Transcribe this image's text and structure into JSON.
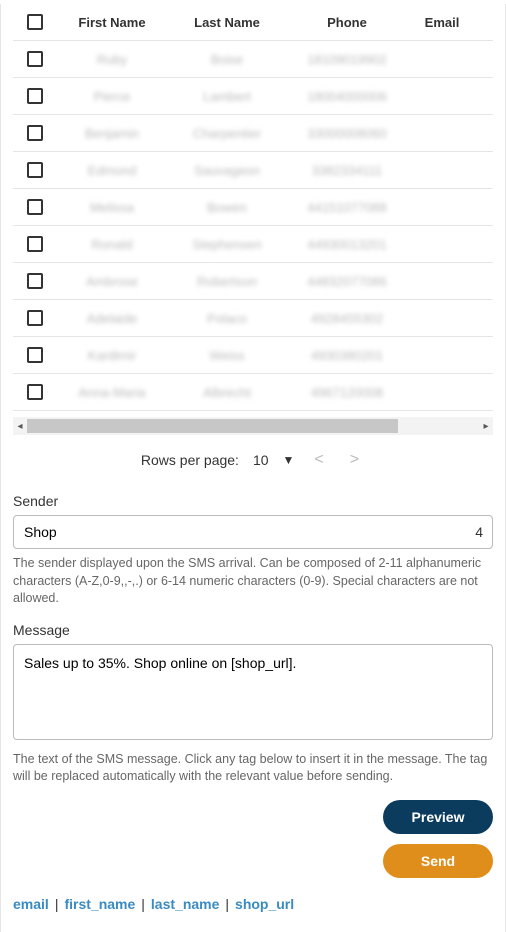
{
  "table": {
    "headers": {
      "first": "First Name",
      "last": "Last Name",
      "phone": "Phone",
      "email": "Email"
    },
    "rows": [
      {
        "first": "Ruby",
        "last": "Boise",
        "phone": "18109019902"
      },
      {
        "first": "Pierce",
        "last": "Lambert",
        "phone": "18004000006"
      },
      {
        "first": "Benjamin",
        "last": "Charpentier",
        "phone": "33000008060"
      },
      {
        "first": "Edmond",
        "last": "Sauvageon",
        "phone": "3382334111"
      },
      {
        "first": "Melissa",
        "last": "Bowen",
        "phone": "44151077088"
      },
      {
        "first": "Ronald",
        "last": "Stephensen",
        "phone": "44930013201"
      },
      {
        "first": "Ambrose",
        "last": "Robertson",
        "phone": "44832077086"
      },
      {
        "first": "Adelaide",
        "last": "Polaco",
        "phone": "4928455302"
      },
      {
        "first": "Kardimir",
        "last": "Weiss",
        "phone": "4930380201"
      },
      {
        "first": "Anna-Maria",
        "last": "Albrecht",
        "phone": "4967120008"
      }
    ]
  },
  "pager": {
    "label": "Rows per page:",
    "value": "10"
  },
  "sender": {
    "label": "Sender",
    "value": "Shop",
    "counter": "4",
    "help": "The sender displayed upon the SMS arrival. Can be composed of 2-11 alphanumeric characters (A-Z,0-9,,-,.) or 6-14 numeric characters (0-9). Special characters are not allowed."
  },
  "message": {
    "label": "Message",
    "value": "Sales up to 35%. Shop online on [shop_url].",
    "help": "The text of the SMS message. Click any tag below to insert it in the message. The tag will be replaced automatically with the relevant value before sending."
  },
  "buttons": {
    "preview": "Preview",
    "send": "Send"
  },
  "tags": [
    "email",
    "first_name",
    "last_name",
    "shop_url"
  ]
}
